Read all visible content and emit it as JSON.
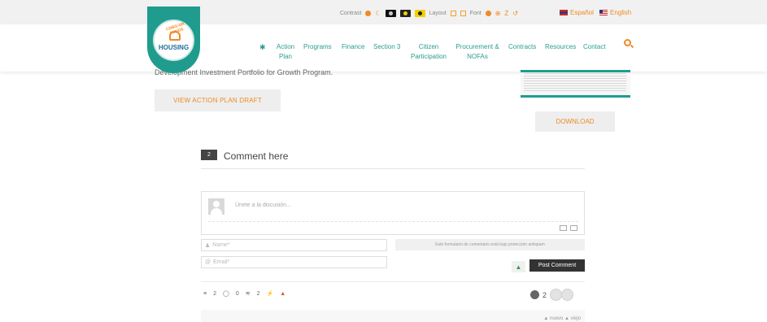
{
  "accessibility": {
    "contrast_label": "Contrast",
    "layout_label": "Layout",
    "font_label": "Font",
    "font_plus": "⊕",
    "font_reset": "Z",
    "font_undo": "↺"
  },
  "language": {
    "spanish": "Español",
    "english": "English"
  },
  "logo": {
    "arc_text": "CDBG-DR FUNDS",
    "text": "HOUSING"
  },
  "nav": {
    "action_plan_1": "Action",
    "action_plan_2": "Plan",
    "programs": "Programs",
    "finance": "Finance",
    "section3": "Section 3",
    "citizen_1": "Citizen",
    "citizen_2": "Participation",
    "procurement_1": "Procurement &",
    "procurement_2": "NOFAs",
    "contracts": "Contracts",
    "resources": "Resources",
    "contact": "Contact"
  },
  "content": {
    "cut_text": "Development Investment Portfolio for Growth Program.",
    "draft_button": "VIEW ACTION PLAN DRAFT",
    "download_button": "DOWNLOAD"
  },
  "comments": {
    "count_badge": "2",
    "title": "Comment here",
    "placeholder": "Únete a la discusión...",
    "name_placeholder": "Name*",
    "email_placeholder": "Email*",
    "gdpr_notice": "Este formulario de comentario está bajo protección antispam",
    "post_button": "Post Comment",
    "stat_threads": "2",
    "stat_replies": "0",
    "stat_followers": "2",
    "follower_count": "2",
    "sort_text": "▲ nuevo ▲ viejo"
  },
  "colors": {
    "teal": "#2a9d8f",
    "orange": "#f08a24",
    "dark_button": "#333333"
  }
}
